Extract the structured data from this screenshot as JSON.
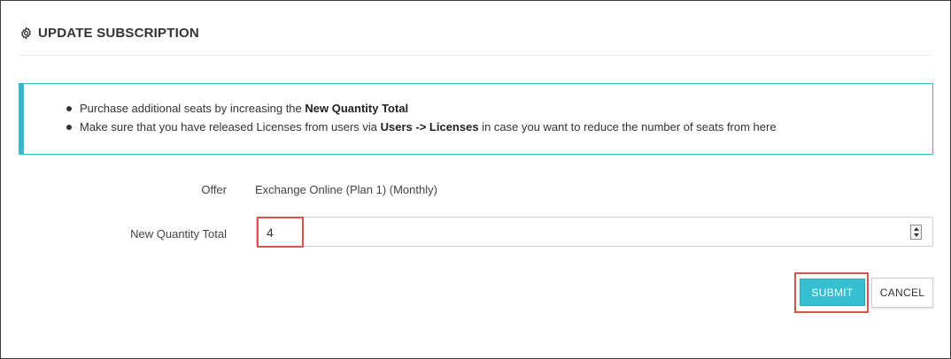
{
  "header": {
    "title": "UPDATE SUBSCRIPTION",
    "icon": "gear-icon"
  },
  "info": {
    "items": [
      {
        "before": "Purchase additional seats by increasing the ",
        "bold": "New Quantity Total",
        "after": ""
      },
      {
        "before": "Make sure that you have released Licenses from users via ",
        "bold": "Users -> Licenses",
        "after": " in case you want to reduce the number of seats from here"
      }
    ]
  },
  "form": {
    "offer_label": "Offer",
    "offer_value": "Exchange Online (Plan 1) (Monthly)",
    "quantity_label": "New Quantity Total",
    "quantity_value": "4"
  },
  "actions": {
    "submit_label": "SUBMIT",
    "cancel_label": "CANCEL"
  },
  "colors": {
    "accent": "#36bfd1",
    "highlight": "#d9534f"
  }
}
